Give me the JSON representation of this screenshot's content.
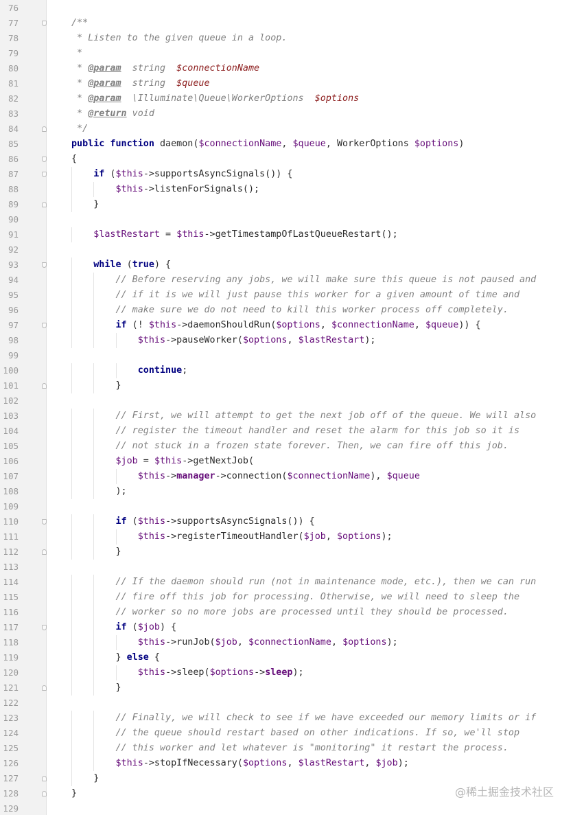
{
  "editor": {
    "gutter_color": "#f2f2f2",
    "lines": [
      {
        "num": "76",
        "fold": "",
        "tokens": []
      },
      {
        "num": "77",
        "fold": "open",
        "tokens": [
          {
            "t": "/**",
            "c": "cmt"
          }
        ]
      },
      {
        "num": "78",
        "fold": "",
        "tokens": [
          {
            "t": " * Listen to the given queue in a loop.",
            "c": "cmt"
          }
        ]
      },
      {
        "num": "79",
        "fold": "",
        "tokens": [
          {
            "t": " *",
            "c": "cmt"
          }
        ]
      },
      {
        "num": "80",
        "fold": "",
        "tokens": [
          {
            "t": " * ",
            "c": "cmt"
          },
          {
            "t": "@param",
            "c": "tag"
          },
          {
            "t": "  string  ",
            "c": "cmt"
          },
          {
            "t": "$connectionName",
            "c": "pvar"
          }
        ]
      },
      {
        "num": "81",
        "fold": "",
        "tokens": [
          {
            "t": " * ",
            "c": "cmt"
          },
          {
            "t": "@param",
            "c": "tag"
          },
          {
            "t": "  string  ",
            "c": "cmt"
          },
          {
            "t": "$queue",
            "c": "pvar"
          }
        ]
      },
      {
        "num": "82",
        "fold": "",
        "tokens": [
          {
            "t": " * ",
            "c": "cmt"
          },
          {
            "t": "@param",
            "c": "tag"
          },
          {
            "t": "  \\Illuminate\\Queue\\WorkerOptions  ",
            "c": "cmt"
          },
          {
            "t": "$options",
            "c": "pvar"
          }
        ]
      },
      {
        "num": "83",
        "fold": "",
        "tokens": [
          {
            "t": " * ",
            "c": "cmt"
          },
          {
            "t": "@return",
            "c": "tag"
          },
          {
            "t": " void",
            "c": "cmt"
          }
        ]
      },
      {
        "num": "84",
        "fold": "close",
        "tokens": [
          {
            "t": " */",
            "c": "cmt"
          }
        ]
      },
      {
        "num": "85",
        "fold": "",
        "tokens": [
          {
            "t": "public function",
            "c": "kw"
          },
          {
            "t": " daemon(",
            "c": ""
          },
          {
            "t": "$connectionName",
            "c": "var"
          },
          {
            "t": ", ",
            "c": ""
          },
          {
            "t": "$queue",
            "c": "var"
          },
          {
            "t": ", WorkerOptions ",
            "c": ""
          },
          {
            "t": "$options",
            "c": "var"
          },
          {
            "t": ")",
            "c": ""
          }
        ]
      },
      {
        "num": "86",
        "fold": "open",
        "tokens": [
          {
            "t": "{",
            "c": ""
          }
        ]
      },
      {
        "num": "87",
        "fold": "open",
        "tokens": [
          {
            "t": "    ",
            "c": ""
          },
          {
            "t": "if",
            "c": "kw"
          },
          {
            "t": " (",
            "c": ""
          },
          {
            "t": "$this",
            "c": "var"
          },
          {
            "t": "->supportsAsyncSignals()) {",
            "c": ""
          }
        ]
      },
      {
        "num": "88",
        "fold": "",
        "tokens": [
          {
            "t": "        ",
            "c": ""
          },
          {
            "t": "$this",
            "c": "var"
          },
          {
            "t": "->listenForSignals();",
            "c": ""
          }
        ]
      },
      {
        "num": "89",
        "fold": "close",
        "tokens": [
          {
            "t": "    }",
            "c": ""
          }
        ]
      },
      {
        "num": "90",
        "fold": "",
        "tokens": []
      },
      {
        "num": "91",
        "fold": "",
        "tokens": [
          {
            "t": "    ",
            "c": ""
          },
          {
            "t": "$lastRestart",
            "c": "var"
          },
          {
            "t": " = ",
            "c": ""
          },
          {
            "t": "$this",
            "c": "var"
          },
          {
            "t": "->getTimestampOfLastQueueRestart();",
            "c": ""
          }
        ]
      },
      {
        "num": "92",
        "fold": "",
        "tokens": []
      },
      {
        "num": "93",
        "fold": "open",
        "tokens": [
          {
            "t": "    ",
            "c": ""
          },
          {
            "t": "while",
            "c": "kw"
          },
          {
            "t": " (",
            "c": ""
          },
          {
            "t": "true",
            "c": "kw"
          },
          {
            "t": ") {",
            "c": ""
          }
        ]
      },
      {
        "num": "94",
        "fold": "",
        "tokens": [
          {
            "t": "        ",
            "c": ""
          },
          {
            "t": "// Before reserving any jobs, we will make sure this queue is not paused and",
            "c": "cmt"
          }
        ]
      },
      {
        "num": "95",
        "fold": "",
        "tokens": [
          {
            "t": "        ",
            "c": ""
          },
          {
            "t": "// if it is we will just pause this worker for a given amount of time and",
            "c": "cmt"
          }
        ]
      },
      {
        "num": "96",
        "fold": "",
        "tokens": [
          {
            "t": "        ",
            "c": ""
          },
          {
            "t": "// make sure we do not need to kill this worker process off completely.",
            "c": "cmt"
          }
        ]
      },
      {
        "num": "97",
        "fold": "open",
        "tokens": [
          {
            "t": "        ",
            "c": ""
          },
          {
            "t": "if",
            "c": "kw"
          },
          {
            "t": " (! ",
            "c": ""
          },
          {
            "t": "$this",
            "c": "var"
          },
          {
            "t": "->daemonShouldRun(",
            "c": ""
          },
          {
            "t": "$options",
            "c": "var"
          },
          {
            "t": ", ",
            "c": ""
          },
          {
            "t": "$connectionName",
            "c": "var"
          },
          {
            "t": ", ",
            "c": ""
          },
          {
            "t": "$queue",
            "c": "var"
          },
          {
            "t": ")) {",
            "c": ""
          }
        ]
      },
      {
        "num": "98",
        "fold": "",
        "tokens": [
          {
            "t": "            ",
            "c": ""
          },
          {
            "t": "$this",
            "c": "var"
          },
          {
            "t": "->pauseWorker(",
            "c": ""
          },
          {
            "t": "$options",
            "c": "var"
          },
          {
            "t": ", ",
            "c": ""
          },
          {
            "t": "$lastRestart",
            "c": "var"
          },
          {
            "t": ");",
            "c": ""
          }
        ]
      },
      {
        "num": "99",
        "fold": "",
        "tokens": []
      },
      {
        "num": "100",
        "fold": "",
        "tokens": [
          {
            "t": "            ",
            "c": ""
          },
          {
            "t": "continue",
            "c": "kw"
          },
          {
            "t": ";",
            "c": ""
          }
        ]
      },
      {
        "num": "101",
        "fold": "close",
        "tokens": [
          {
            "t": "        }",
            "c": ""
          }
        ]
      },
      {
        "num": "102",
        "fold": "",
        "tokens": []
      },
      {
        "num": "103",
        "fold": "",
        "tokens": [
          {
            "t": "        ",
            "c": ""
          },
          {
            "t": "// First, we will attempt to get the next job off of the queue. We will also",
            "c": "cmt"
          }
        ]
      },
      {
        "num": "104",
        "fold": "",
        "tokens": [
          {
            "t": "        ",
            "c": ""
          },
          {
            "t": "// register the timeout handler and reset the alarm for this job so it is",
            "c": "cmt"
          }
        ]
      },
      {
        "num": "105",
        "fold": "",
        "tokens": [
          {
            "t": "        ",
            "c": ""
          },
          {
            "t": "// not stuck in a frozen state forever. Then, we can fire off this job.",
            "c": "cmt"
          }
        ]
      },
      {
        "num": "106",
        "fold": "",
        "tokens": [
          {
            "t": "        ",
            "c": ""
          },
          {
            "t": "$job",
            "c": "var"
          },
          {
            "t": " = ",
            "c": ""
          },
          {
            "t": "$this",
            "c": "var"
          },
          {
            "t": "->getNextJob(",
            "c": ""
          }
        ]
      },
      {
        "num": "107",
        "fold": "",
        "tokens": [
          {
            "t": "            ",
            "c": ""
          },
          {
            "t": "$this",
            "c": "var"
          },
          {
            "t": "->",
            "c": ""
          },
          {
            "t": "manager",
            "c": "fld"
          },
          {
            "t": "->connection(",
            "c": ""
          },
          {
            "t": "$connectionName",
            "c": "var"
          },
          {
            "t": "), ",
            "c": ""
          },
          {
            "t": "$queue",
            "c": "var"
          }
        ]
      },
      {
        "num": "108",
        "fold": "",
        "tokens": [
          {
            "t": "        );",
            "c": ""
          }
        ]
      },
      {
        "num": "109",
        "fold": "",
        "tokens": []
      },
      {
        "num": "110",
        "fold": "open",
        "tokens": [
          {
            "t": "        ",
            "c": ""
          },
          {
            "t": "if",
            "c": "kw"
          },
          {
            "t": " (",
            "c": ""
          },
          {
            "t": "$this",
            "c": "var"
          },
          {
            "t": "->supportsAsyncSignals()) {",
            "c": ""
          }
        ]
      },
      {
        "num": "111",
        "fold": "",
        "tokens": [
          {
            "t": "            ",
            "c": ""
          },
          {
            "t": "$this",
            "c": "var"
          },
          {
            "t": "->registerTimeoutHandler(",
            "c": ""
          },
          {
            "t": "$job",
            "c": "var"
          },
          {
            "t": ", ",
            "c": ""
          },
          {
            "t": "$options",
            "c": "var"
          },
          {
            "t": ");",
            "c": ""
          }
        ]
      },
      {
        "num": "112",
        "fold": "close",
        "tokens": [
          {
            "t": "        }",
            "c": ""
          }
        ]
      },
      {
        "num": "113",
        "fold": "",
        "tokens": []
      },
      {
        "num": "114",
        "fold": "",
        "tokens": [
          {
            "t": "        ",
            "c": ""
          },
          {
            "t": "// If the daemon should run (not in maintenance mode, etc.), then we can run",
            "c": "cmt"
          }
        ]
      },
      {
        "num": "115",
        "fold": "",
        "tokens": [
          {
            "t": "        ",
            "c": ""
          },
          {
            "t": "// fire off this job for processing. Otherwise, we will need to sleep the",
            "c": "cmt"
          }
        ]
      },
      {
        "num": "116",
        "fold": "",
        "tokens": [
          {
            "t": "        ",
            "c": ""
          },
          {
            "t": "// worker so no more jobs are processed until they should be processed.",
            "c": "cmt"
          }
        ]
      },
      {
        "num": "117",
        "fold": "open",
        "tokens": [
          {
            "t": "        ",
            "c": ""
          },
          {
            "t": "if",
            "c": "kw"
          },
          {
            "t": " (",
            "c": ""
          },
          {
            "t": "$job",
            "c": "var"
          },
          {
            "t": ") {",
            "c": ""
          }
        ]
      },
      {
        "num": "118",
        "fold": "",
        "tokens": [
          {
            "t": "            ",
            "c": ""
          },
          {
            "t": "$this",
            "c": "var"
          },
          {
            "t": "->runJob(",
            "c": ""
          },
          {
            "t": "$job",
            "c": "var"
          },
          {
            "t": ", ",
            "c": ""
          },
          {
            "t": "$connectionName",
            "c": "var"
          },
          {
            "t": ", ",
            "c": ""
          },
          {
            "t": "$options",
            "c": "var"
          },
          {
            "t": ");",
            "c": ""
          }
        ]
      },
      {
        "num": "119",
        "fold": "",
        "tokens": [
          {
            "t": "        } ",
            "c": ""
          },
          {
            "t": "else",
            "c": "kw"
          },
          {
            "t": " {",
            "c": ""
          }
        ]
      },
      {
        "num": "120",
        "fold": "",
        "tokens": [
          {
            "t": "            ",
            "c": ""
          },
          {
            "t": "$this",
            "c": "var"
          },
          {
            "t": "->sleep(",
            "c": ""
          },
          {
            "t": "$options",
            "c": "var"
          },
          {
            "t": "->",
            "c": ""
          },
          {
            "t": "sleep",
            "c": "fld"
          },
          {
            "t": ");",
            "c": ""
          }
        ]
      },
      {
        "num": "121",
        "fold": "close",
        "tokens": [
          {
            "t": "        }",
            "c": ""
          }
        ]
      },
      {
        "num": "122",
        "fold": "",
        "tokens": []
      },
      {
        "num": "123",
        "fold": "",
        "tokens": [
          {
            "t": "        ",
            "c": ""
          },
          {
            "t": "// Finally, we will check to see if we have exceeded our memory limits or if",
            "c": "cmt"
          }
        ]
      },
      {
        "num": "124",
        "fold": "",
        "tokens": [
          {
            "t": "        ",
            "c": ""
          },
          {
            "t": "// the queue should restart based on other indications. If so, we'll stop",
            "c": "cmt"
          }
        ]
      },
      {
        "num": "125",
        "fold": "",
        "tokens": [
          {
            "t": "        ",
            "c": ""
          },
          {
            "t": "// this worker and let whatever is \"monitoring\" it restart the process.",
            "c": "cmt"
          }
        ]
      },
      {
        "num": "126",
        "fold": "",
        "tokens": [
          {
            "t": "        ",
            "c": ""
          },
          {
            "t": "$this",
            "c": "var"
          },
          {
            "t": "->stopIfNecessary(",
            "c": ""
          },
          {
            "t": "$options",
            "c": "var"
          },
          {
            "t": ", ",
            "c": ""
          },
          {
            "t": "$lastRestart",
            "c": "var"
          },
          {
            "t": ", ",
            "c": ""
          },
          {
            "t": "$job",
            "c": "var"
          },
          {
            "t": ");",
            "c": ""
          }
        ]
      },
      {
        "num": "127",
        "fold": "close",
        "tokens": [
          {
            "t": "    }",
            "c": ""
          }
        ]
      },
      {
        "num": "128",
        "fold": "close",
        "tokens": [
          {
            "t": "}",
            "c": ""
          }
        ]
      },
      {
        "num": "129",
        "fold": "",
        "tokens": []
      }
    ]
  },
  "watermark": "@稀土掘金技术社区"
}
